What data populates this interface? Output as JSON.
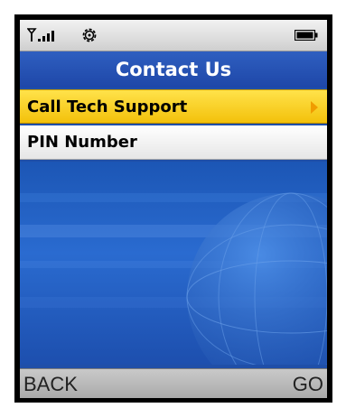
{
  "status_bar": {
    "signal_icon": "signal-strength-icon",
    "settings_icon": "gear-icon",
    "battery_icon": "battery-icon"
  },
  "title": "Contact Us",
  "menu": {
    "items": [
      {
        "label": "Call Tech Support",
        "selected": true,
        "has_submenu": true
      },
      {
        "label": "PIN Number",
        "selected": false,
        "has_submenu": false
      }
    ]
  },
  "softkeys": {
    "left": "BACK",
    "right": "GO"
  },
  "colors": {
    "title_bar": "#2f5fc0",
    "selected_item": "#f3c10b",
    "wallpaper": "#1f4fa8",
    "softkey_bar": "#b8b8b8"
  }
}
